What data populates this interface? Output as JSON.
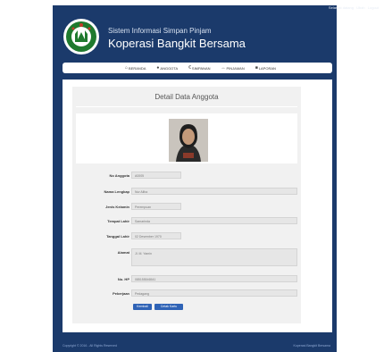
{
  "colors": {
    "frame": "#1b3a6b",
    "accent": "#2f63b6"
  },
  "topbar": {
    "links": [
      "Selamat datang",
      "Ubah",
      "Logout"
    ]
  },
  "brand": {
    "subtitle": "Sistem Informasi Simpan Pinjam",
    "title": "Koperasi Bangkit Bersama",
    "logo_icon": "cooperative-logo-icon"
  },
  "nav": [
    {
      "label": "BERANDA",
      "icon": "home-icon"
    },
    {
      "label": "ANGGOTA",
      "icon": "user-icon"
    },
    {
      "label": "SIMPANAN",
      "icon": "euro-icon"
    },
    {
      "label": "PINJAMAN",
      "icon": "pinjaman-icon"
    },
    {
      "label": "LAPORAN",
      "icon": "report-icon"
    }
  ],
  "detail": {
    "title": "Detail Data Anggota"
  },
  "fields": [
    {
      "label": "No Anggota",
      "value": "A0005"
    },
    {
      "label": "Nama Lengkap",
      "value": "Nur Aliha"
    },
    {
      "label": "Jenis Kelamin",
      "value": "Perempuan"
    },
    {
      "label": "Tempat Lahir",
      "value": "Samarinda"
    },
    {
      "label": "Tanggal Lahir",
      "value": "02 Desember 1970"
    },
    {
      "label": "Alamat",
      "value": "Jl. M. Yamin"
    },
    {
      "label": "No. HP",
      "value": "085155546541"
    },
    {
      "label": "Pekerjaan",
      "value": "Pedagang"
    }
  ],
  "buttons": {
    "back": "Kembali",
    "print": "Cetak Kartu"
  },
  "footer": {
    "left": "Copyright © 2016 - All Rights Reserved",
    "right": "Koperasi Bangkit Bersama"
  }
}
